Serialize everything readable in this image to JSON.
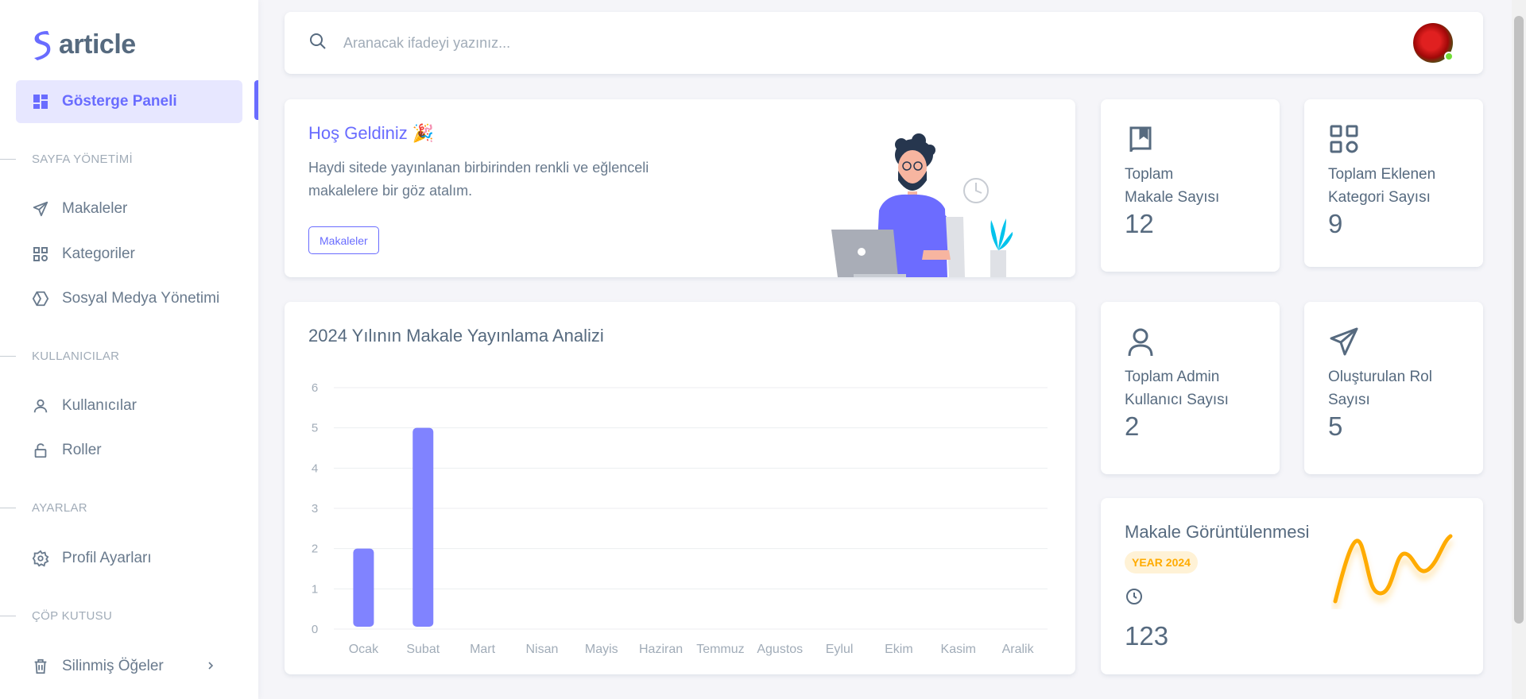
{
  "brand": {
    "name": "article",
    "accent": "#696cff"
  },
  "sidebar": {
    "active": {
      "label": "Gösterge Paneli",
      "icon": "dashboard-icon"
    },
    "sections": [
      {
        "title": "SAYFA YÖNETİMİ",
        "items": [
          {
            "label": "Makaleler",
            "icon": "send-icon"
          },
          {
            "label": "Kategoriler",
            "icon": "grid-icon"
          },
          {
            "label": "Sosyal Medya Yönetimi",
            "icon": "hexagon-icon"
          }
        ]
      },
      {
        "title": "KULLANICILAR",
        "items": [
          {
            "label": "Kullanıcılar",
            "icon": "user-icon"
          },
          {
            "label": "Roller",
            "icon": "lock-open-icon"
          }
        ]
      },
      {
        "title": "AYARLAR",
        "items": [
          {
            "label": "Profil Ayarları",
            "icon": "gear-icon"
          }
        ]
      },
      {
        "title": "ÇÖP KUTUSU",
        "items": [
          {
            "label": "Silinmiş Öğeler",
            "icon": "trash-icon"
          }
        ]
      }
    ]
  },
  "search": {
    "placeholder": "Aranacak ifadeyi yazınız..."
  },
  "welcome": {
    "title": "Hoş Geldiniz 🎉",
    "text": "Haydi sitede yayınlanan birbirinden renkli ve eğlenceli makalelere bir göz atalım.",
    "button": "Makaleler"
  },
  "stats": [
    {
      "label_line1": "Toplam",
      "label_line2": "Makale Sayısı",
      "value": "12",
      "icon": "book-icon"
    },
    {
      "label_line1": "Toplam Eklenen",
      "label_line2": "Kategori Sayısı",
      "value": "9",
      "icon": "grid-icon"
    },
    {
      "label_line1": "Toplam Admin",
      "label_line2": "Kullanıcı Sayısı",
      "value": "2",
      "icon": "user-icon"
    },
    {
      "label_line1": "Oluşturulan Rol",
      "label_line2": "Sayısı",
      "value": "5",
      "icon": "send-icon"
    }
  ],
  "views": {
    "title": "Makale Görüntülenmesi",
    "badge": "YEAR 2024",
    "value": "123",
    "icon": "clock-icon",
    "spark_color": "#ffab00"
  },
  "chart": {
    "title": "2024 Yılının Makale Yayınlama Analizi"
  },
  "chart_data": {
    "type": "bar",
    "title": "2024 Yılının Makale Yayınlama Analizi",
    "categories": [
      "Ocak",
      "Subat",
      "Mart",
      "Nisan",
      "Mayis",
      "Haziran",
      "Temmuz",
      "Agustos",
      "Eylul",
      "Ekim",
      "Kasim",
      "Aralik"
    ],
    "values": [
      2,
      5,
      0,
      0,
      0,
      0,
      0,
      0,
      0,
      0,
      0,
      0
    ],
    "ylim": [
      0,
      6
    ],
    "yticks": [
      "0",
      "1",
      "2",
      "3",
      "4",
      "5",
      "6"
    ],
    "grid": true,
    "bar_color": "#8083ff"
  }
}
